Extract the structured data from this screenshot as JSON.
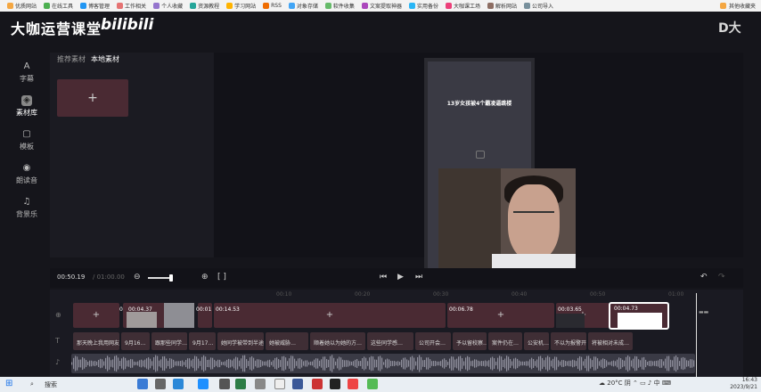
{
  "bookmarks": [
    "优质网站",
    "在线工具",
    "博客管理",
    "工作相关",
    "个人收藏",
    "资源教程",
    "学习网站",
    "RSS",
    "对象存储",
    "软件收集",
    "文案提取神器",
    "实用备份",
    "大咖课工场",
    "解析网站",
    "公司导入"
  ],
  "bookmarks_right": "其他收藏夹",
  "header": {
    "logo_text": "大咖运营课堂",
    "logo_bili": "bilibili",
    "brand": "D大"
  },
  "nav": [
    {
      "icon": "A",
      "label": "字幕"
    },
    {
      "icon": "◈",
      "label": "素材库"
    },
    {
      "icon": "▢",
      "label": "模板"
    },
    {
      "icon": "◉",
      "label": "朗读音"
    },
    {
      "icon": "♫",
      "label": "背景乐"
    }
  ],
  "material": {
    "tabs": [
      "推荐素材",
      "本地素材"
    ],
    "add_label": "+"
  },
  "preview": {
    "title": "13岁女孩被4个霸凌逼跳楼"
  },
  "playback": {
    "current": "00:50.19",
    "total": "/ 01:00.00"
  },
  "timeline": {
    "ruler": [
      "00:10",
      "00:20",
      "00:30",
      "00:40",
      "00:50",
      "01:00"
    ],
    "clip_labels": [
      "0",
      "00:04.37",
      "00:01",
      "00:14.53",
      "00:06.78",
      "00:03.65",
      "00:04.73"
    ],
    "subtitles": [
      "那天晚上我用网友…",
      "9月16…",
      "跟那些同学…",
      "9月17…",
      "她同学被带到半途…",
      "她被威胁…",
      "顺着她以为她的方…",
      "这些同学感…",
      "公司开会…",
      "予以留校察…",
      "案件仍在…",
      "公安机…",
      "不以为报警开…",
      "将被相对未成…"
    ]
  },
  "taskbar": {
    "search": "搜索",
    "weather": "20°C 阴",
    "time": "16:43",
    "date": "2023/9/21"
  }
}
